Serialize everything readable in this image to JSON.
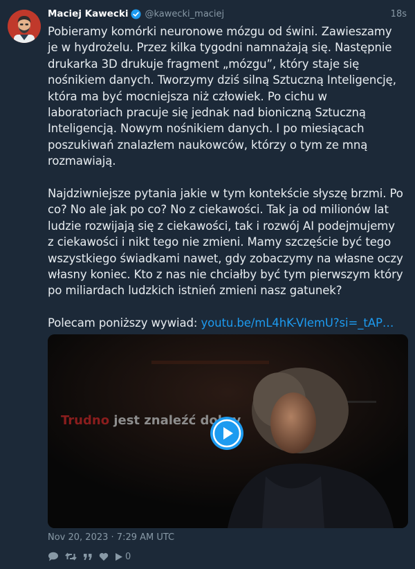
{
  "tweet": {
    "author_name": "Maciej Kawecki",
    "author_handle": "@kawecki_maciej",
    "time_ago": "18s",
    "paragraph1": "Pobieramy komórki neuronowe mózgu od świni. Zawieszamy\nje w hydrożelu. Przez kilka tygodni namnażają się. Następnie\ndrukarka 3D drukuje fragment „mózgu”, który staje się\nnośnikiem danych. Tworzymy dziś silną Sztuczną Inteligencję,\nktóra ma być mocniejsza niż człowiek. Po cichu w\nlaboratoriach pracuje się jednak nad bioniczną Sztuczną\nInteligencją. Nowym nośnikiem danych. I po miesiącach\nposzukiwań znalazłem naukowców, którzy o tym ze mną\nrozmawiają.",
    "paragraph2": "Najdziwniejsze pytania jakie w tym kontekście słyszę brzmi. Po\nco? No ale jak po co? No z ciekawości. Tak ja od milionów lat\nludzie rozwijają się z ciekawości, tak i rozwój AI podejmujemy\nz ciekawości i nikt tego nie zmieni. Mamy szczęście być tego\nwszystkiego świadkami nawet, gdy zobaczymy na własne oczy\nwłasny koniec. Kto z nas nie chciałby być tym pierwszym który\npo miliardach ludzkich istnień zmieni nasz gatunek?",
    "recommend_text": "Polecam poniższy wywiad: ",
    "link_text": "youtu.be/mL4hK-VIemU?si=_tAP…",
    "video_caption_red": "Trudno",
    "video_caption_grey": " jest znaleźć dobry",
    "date": "Nov 20, 2023 · 7:29 AM UTC",
    "views_count": "0"
  },
  "colors": {
    "background": "#1c2938",
    "link": "#1d9bf0",
    "secondary_text": "#8899a6",
    "verified_badge": "#1d9bf0"
  },
  "icons": {
    "verified": "verified-badge-icon",
    "reply": "reply-icon",
    "retweet": "retweet-icon",
    "quote": "quote-icon",
    "like": "heart-icon",
    "views": "play-views-icon",
    "play": "play-icon"
  }
}
